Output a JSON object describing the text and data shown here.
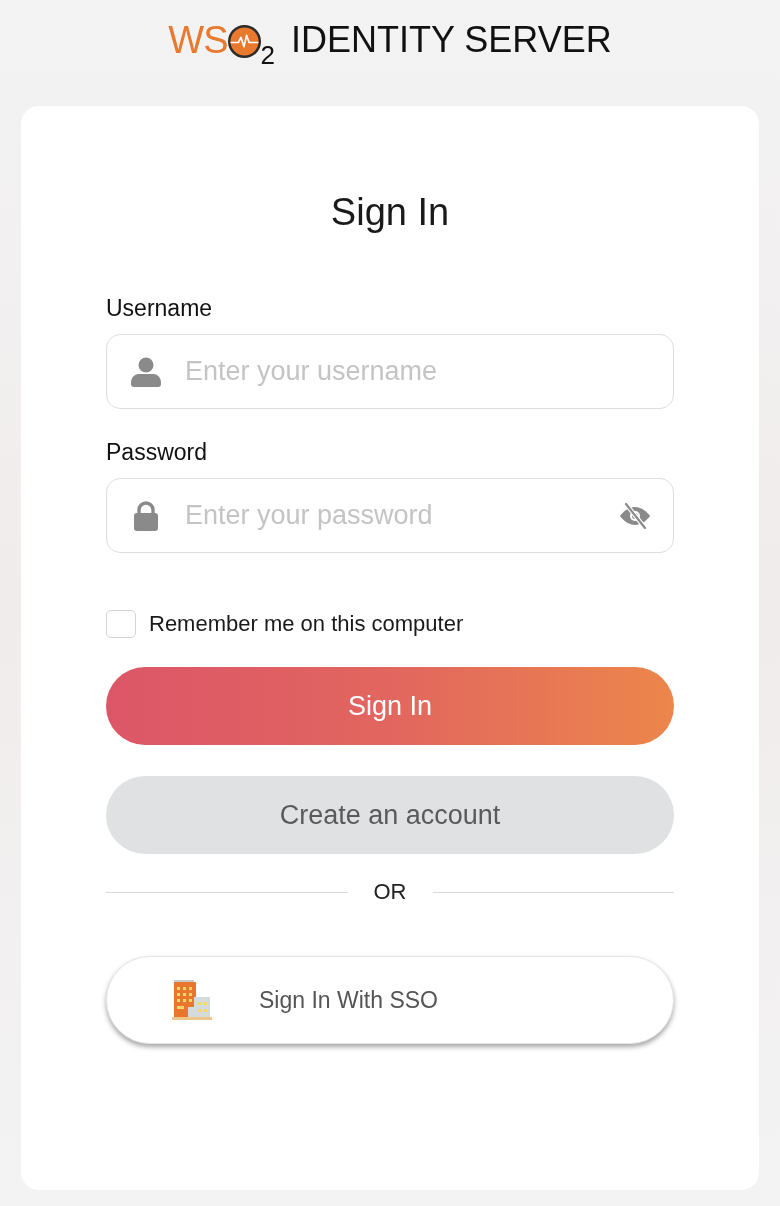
{
  "logo": {
    "brand": "WS",
    "subscript": "2",
    "product": "IDENTITY SERVER"
  },
  "card": {
    "title": "Sign In",
    "fields": [
      {
        "kind": "text",
        "label": "Username",
        "placeholder": "Enter your username"
      },
      {
        "kind": "password",
        "label": "Password",
        "placeholder": "Enter your password"
      }
    ],
    "remember": {
      "label": "Remember me on this computer",
      "checked": false
    },
    "primary_button": "Sign In",
    "secondary_button": "Create an account",
    "divider": "OR",
    "sso_button": "Sign In With SSO"
  }
}
